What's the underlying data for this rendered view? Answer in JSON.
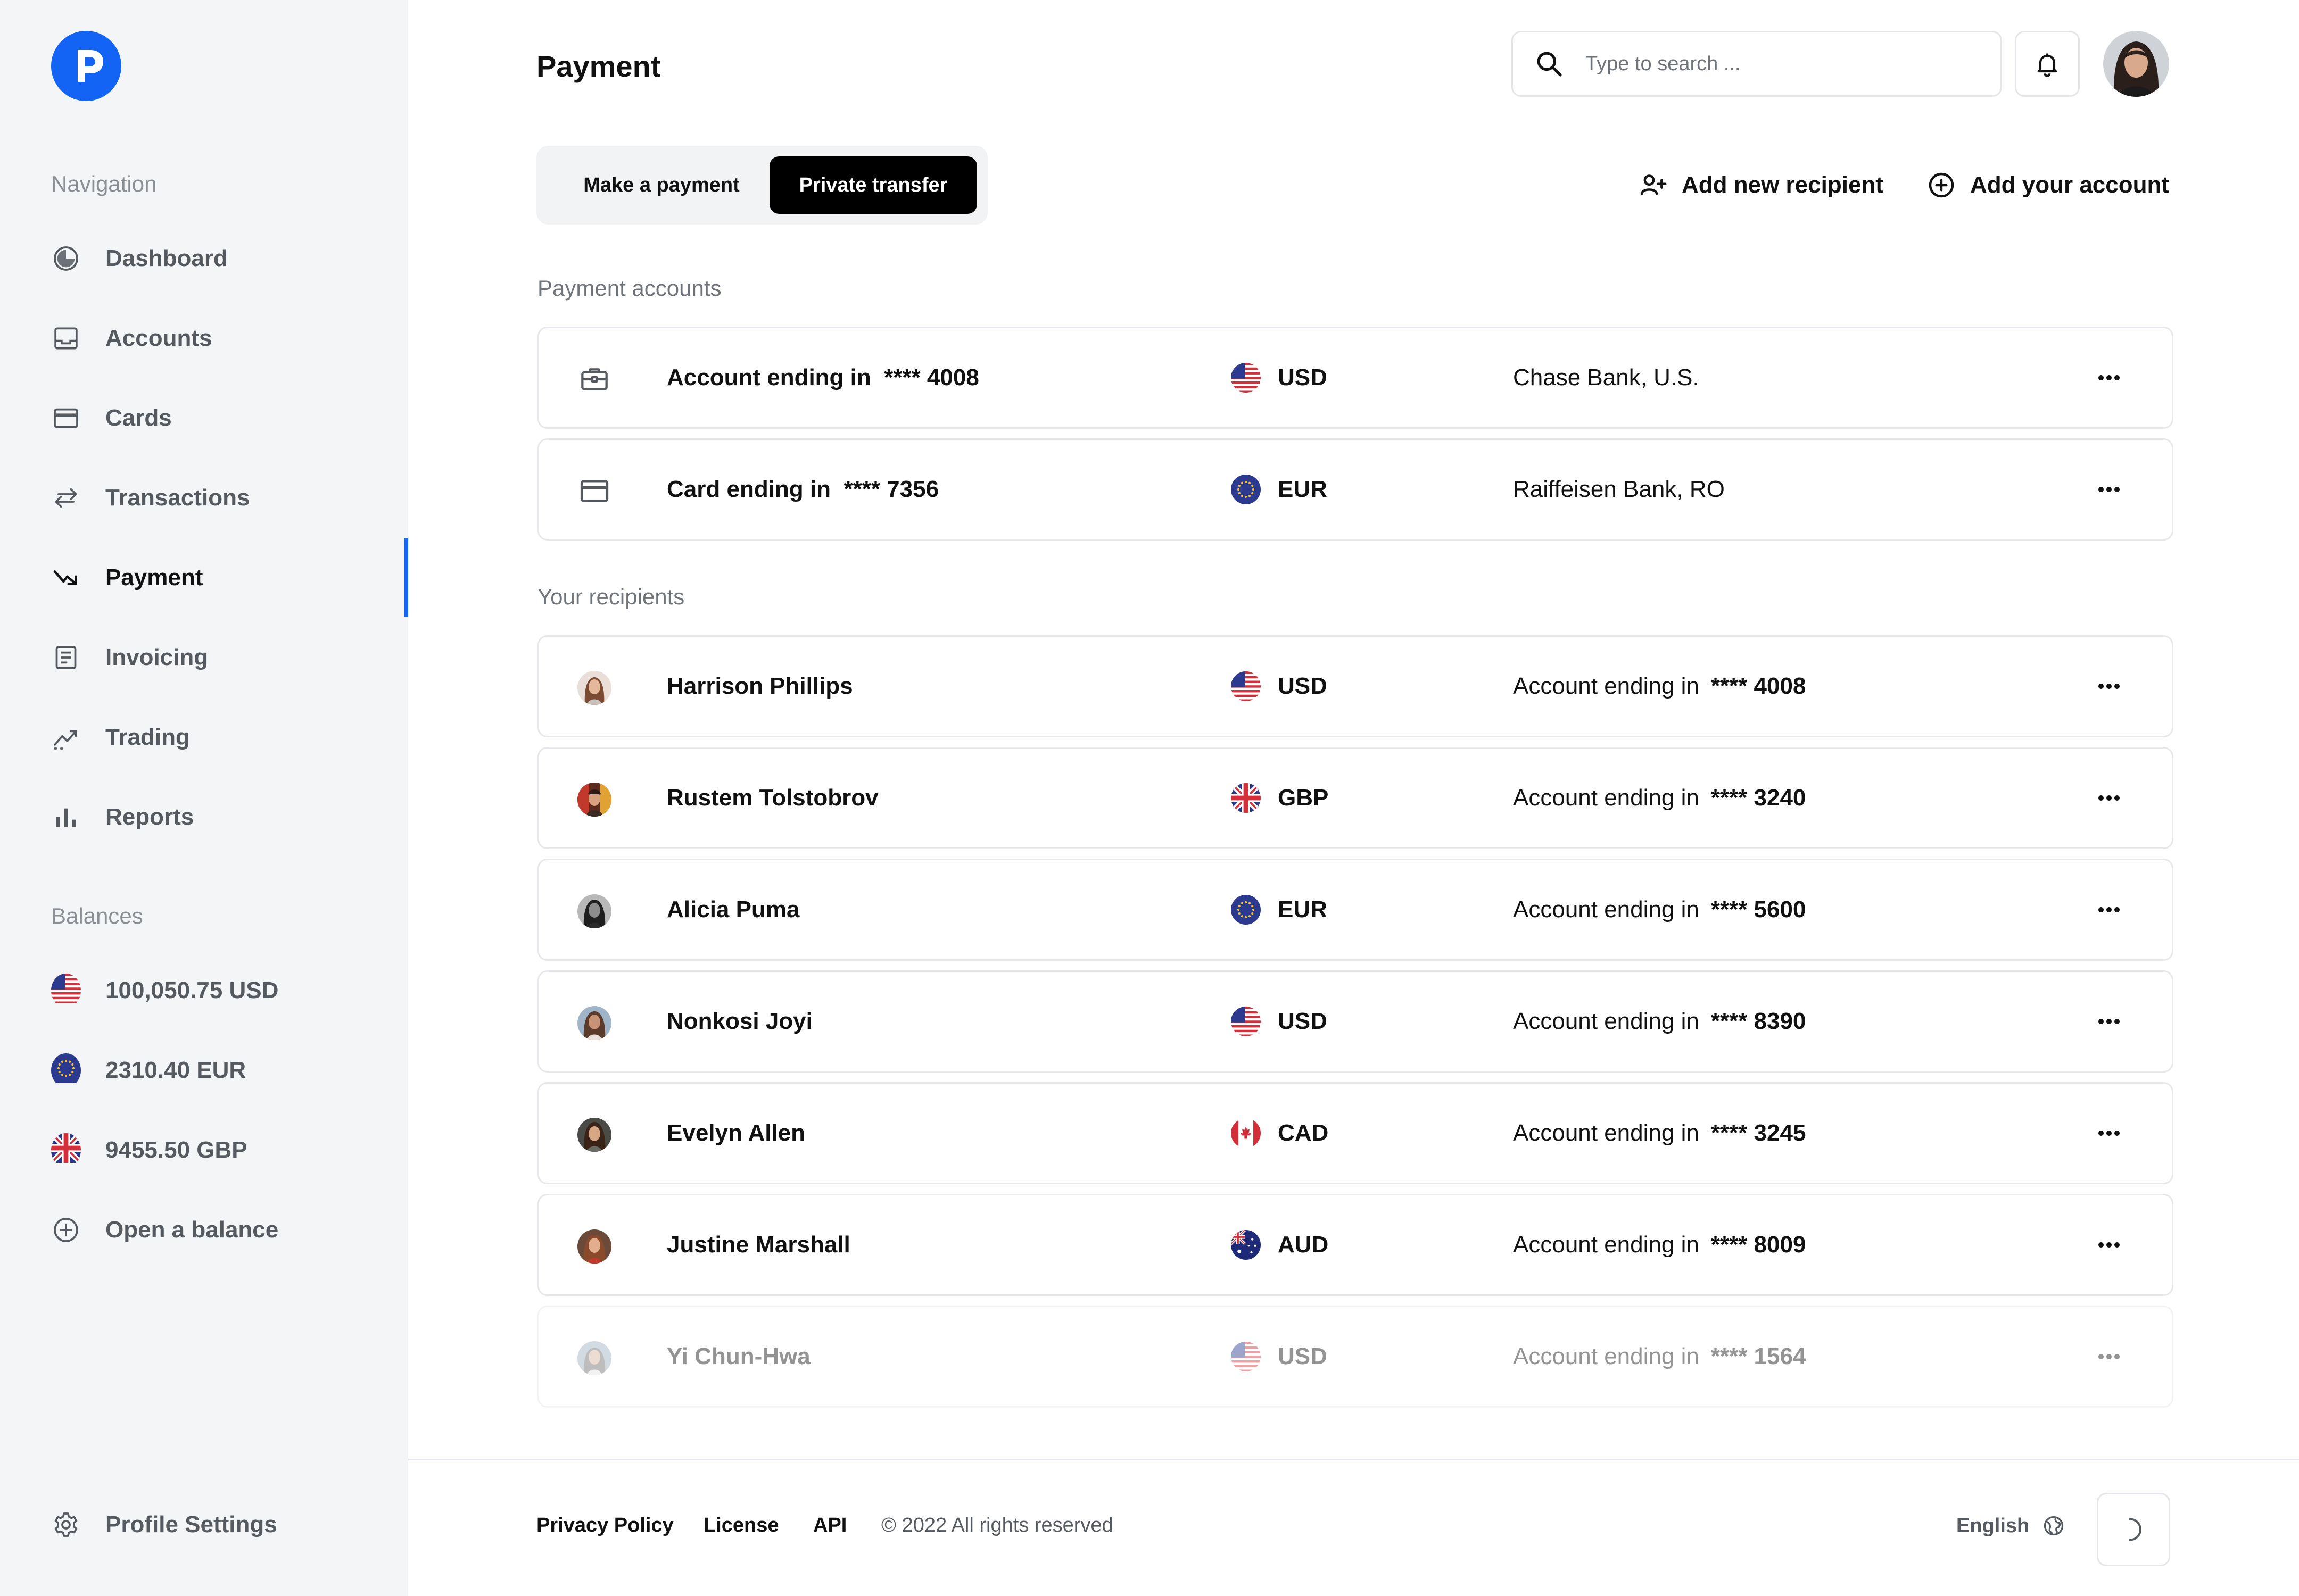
{
  "app": {
    "logo_icon": "p-logo-icon",
    "brand_color": "#1363f4"
  },
  "sidebar": {
    "nav_heading": "Navigation",
    "items": [
      {
        "label": "Dashboard",
        "icon": "dashboard-icon"
      },
      {
        "label": "Accounts",
        "icon": "inbox-icon"
      },
      {
        "label": "Cards",
        "icon": "card-icon"
      },
      {
        "label": "Transactions",
        "icon": "transfer-arrows-icon"
      },
      {
        "label": "Payment",
        "icon": "trend-arrow-icon",
        "active": true
      },
      {
        "label": "Invoicing",
        "icon": "document-icon"
      },
      {
        "label": "Trading",
        "icon": "chart-line-icon"
      },
      {
        "label": "Reports",
        "icon": "bar-chart-icon"
      }
    ],
    "balances_heading": "Balances",
    "balances": [
      {
        "label": "100,050.75 USD",
        "flag": "us-flag-icon"
      },
      {
        "label": "2310.40 EUR",
        "flag": "eu-flag-icon"
      },
      {
        "label": "9455.50 GBP",
        "flag": "uk-flag-icon"
      }
    ],
    "open_balance_label": "Open a balance",
    "profile_settings_label": "Profile Settings"
  },
  "header": {
    "title": "Payment",
    "search_placeholder": "Type to search ..."
  },
  "tabs": {
    "make_payment": "Make a payment",
    "private_transfer": "Private transfer",
    "active": "private_transfer"
  },
  "actions": {
    "add_recipient": "Add new recipient",
    "add_account": "Add your account"
  },
  "payment_accounts": {
    "title": "Payment accounts",
    "rows": [
      {
        "name": "Account ending in  **** 4008",
        "icon": "briefcase-icon",
        "currency": "USD",
        "flag": "us-flag-icon",
        "detail": "Chase Bank, U.S."
      },
      {
        "name": "Card ending in  **** 7356",
        "icon": "card-icon",
        "currency": "EUR",
        "flag": "eu-flag-icon",
        "detail": "Raiffeisen Bank, RO"
      }
    ]
  },
  "recipients": {
    "title": "Your recipients",
    "detail_prefix": "Account ending in",
    "rows": [
      {
        "name": "Harrison Phillips",
        "currency": "USD",
        "flag": "us-flag-icon",
        "account": "**** 4008"
      },
      {
        "name": "Rustem Tolstobrov",
        "currency": "GBP",
        "flag": "uk-flag-icon",
        "account": "**** 3240"
      },
      {
        "name": "Alicia Puma",
        "currency": "EUR",
        "flag": "eu-flag-icon",
        "account": "**** 5600"
      },
      {
        "name": "Nonkosi Joyi",
        "currency": "USD",
        "flag": "us-flag-icon",
        "account": "**** 8390"
      },
      {
        "name": "Evelyn Allen",
        "currency": "CAD",
        "flag": "ca-flag-icon",
        "account": "**** 3245"
      },
      {
        "name": "Justine Marshall",
        "currency": "AUD",
        "flag": "au-flag-icon",
        "account": "**** 8009"
      },
      {
        "name": "Yi Chun-Hwa",
        "currency": "USD",
        "flag": "us-flag-icon",
        "account": "**** 1564",
        "faded": true
      }
    ]
  },
  "footer": {
    "privacy": "Privacy Policy",
    "license": "License",
    "api": "API",
    "copyright": "© 2022 All rights reserved",
    "language": "English"
  }
}
